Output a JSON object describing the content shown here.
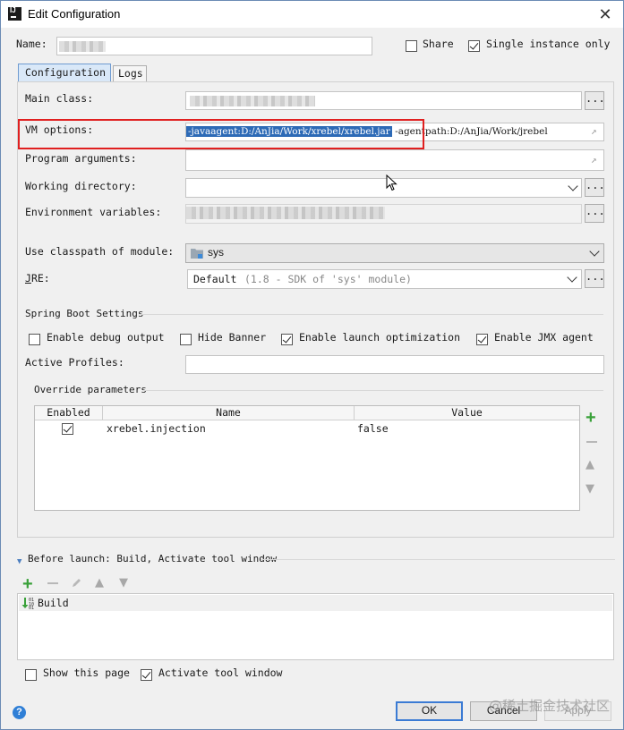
{
  "window": {
    "title": "Edit Configuration",
    "close_label": "✕"
  },
  "name_row": {
    "label": "Name:",
    "share_label": "Share",
    "single_instance_label": "Single instance only",
    "share_checked": false,
    "single_instance_checked": true
  },
  "tabs": [
    {
      "label": "Configuration",
      "active": true
    },
    {
      "label": "Logs",
      "active": false
    }
  ],
  "form": {
    "main_class_label": "Main class:",
    "vm_options_label": "VM options:",
    "vm_options_selected": "-javaagent:D:/AnJia/Work/xrebel/xrebel.jar",
    "vm_options_rest": " -agentpath:D:/AnJia/Work/jrebel",
    "program_arguments_label": "Program arguments:",
    "working_directory_label": "Working directory:",
    "environment_variables_label": "Environment variables:",
    "classpath_label": "Use classpath of module:",
    "classpath_value": "sys",
    "jre_label": "JRE:",
    "jre_value": "Default",
    "jre_hint": "(1.8 - SDK of 'sys' module)",
    "dots": "..."
  },
  "spring_boot": {
    "section_title": "Spring Boot Settings",
    "enable_debug_output": "Enable debug output",
    "hide_banner": "Hide Banner",
    "enable_launch_optimization": "Enable launch optimization",
    "enable_jmx_agent": "Enable JMX agent",
    "debug_checked": false,
    "hide_banner_checked": false,
    "launch_opt_checked": true,
    "jmx_checked": true,
    "active_profiles_label": "Active Profiles:",
    "override_title": "Override parameters",
    "columns": [
      "Enabled",
      "Name",
      "Value"
    ],
    "rows": [
      {
        "enabled": true,
        "name": "xrebel.injection",
        "value": "false"
      }
    ]
  },
  "before_launch": {
    "title": "Before launch: Build, Activate tool window",
    "items": [
      {
        "label": "Build"
      }
    ]
  },
  "footer": {
    "show_this_page": "Show this page",
    "activate_tool_window": "Activate tool window",
    "show_checked": false,
    "activate_checked": true,
    "ok": "OK",
    "cancel": "Cancel",
    "apply": "Apply",
    "help": "?",
    "watermark": "@稀土掘金技术社区"
  }
}
